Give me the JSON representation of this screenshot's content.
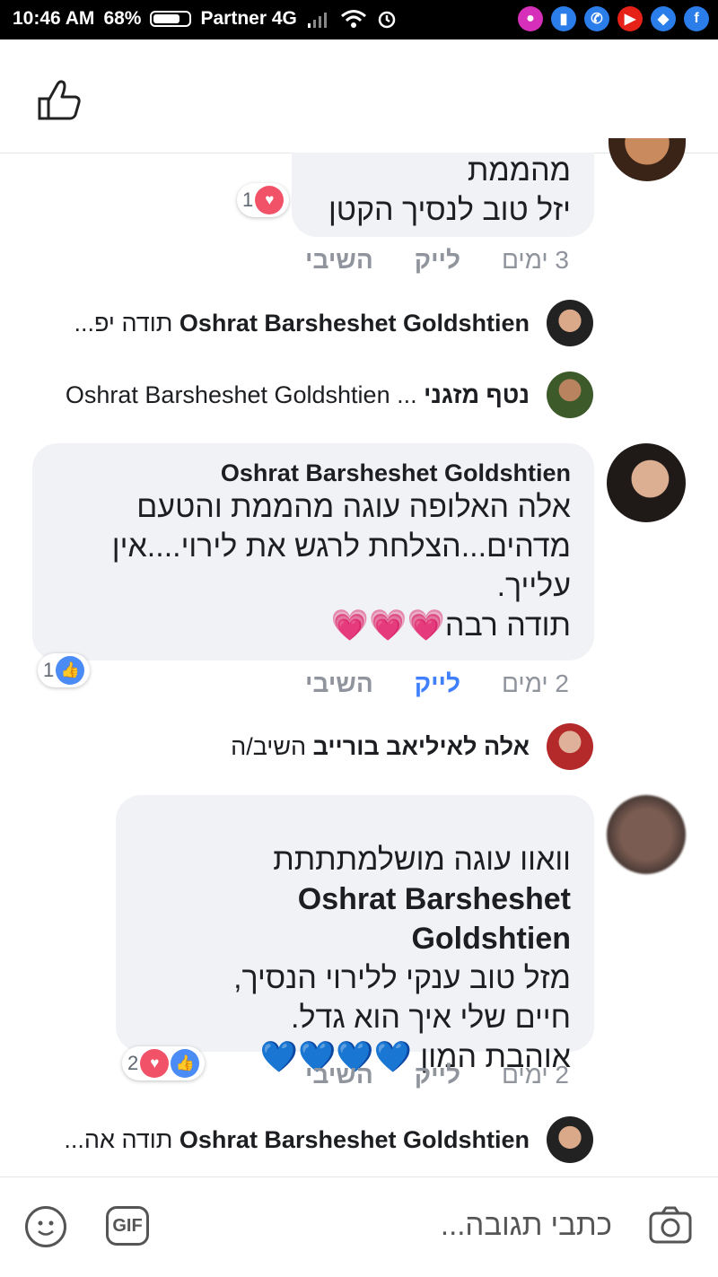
{
  "status_bar": {
    "time": "10:46 AM",
    "battery": "68%",
    "carrier": "Partner 4G",
    "apps": [
      {
        "icon": "messenger-icon",
        "color": "#d62fb9",
        "glyph": "●"
      },
      {
        "icon": "files-icon",
        "color": "#2b7de9",
        "glyph": "▮"
      },
      {
        "icon": "phone-icon",
        "color": "#2b7de9",
        "glyph": "✆"
      },
      {
        "icon": "youtube-icon",
        "color": "#e62117",
        "glyph": "▶"
      },
      {
        "icon": "app-icon",
        "color": "#2b7de9",
        "glyph": "◆"
      },
      {
        "icon": "facebook-icon",
        "color": "#2b7de9",
        "glyph": "f"
      }
    ]
  },
  "comments": {
    "c1": {
      "lines": [
        "מהממת",
        "יזל טוב לנסיך הקטן"
      ],
      "reactions": {
        "count": "1",
        "types": [
          "heart"
        ]
      },
      "time": "3 ימים",
      "like": "לייק",
      "reply": "השיבי"
    },
    "reply1": {
      "name": "Oshrat Barsheshet Goldshtien",
      "text": "תודה יפ..."
    },
    "reply2": {
      "name": "נטף מזגני",
      "text": "... Oshrat Barsheshet Goldshtien"
    },
    "c2": {
      "name": "Oshrat Barsheshet Goldshtien",
      "lines": [
        "אלה האלופה עוגה מהממת והטעם",
        "מדהים...הצלחת לרגש את לירוי....אין",
        "עלייך.",
        "תודה רבה"
      ],
      "emoji": "💗💗💗",
      "reactions": {
        "count": "1",
        "types": [
          "like"
        ]
      },
      "time": "2 ימים",
      "like": "לייק",
      "reply": "השיבי"
    },
    "reply3": {
      "name": "אלה לאיליאב בורייב",
      "text": "השיב/ה"
    },
    "c3": {
      "lines": [
        "וואוו עוגה מושלמתתתת",
        "Oshrat Barsheshet Goldshtien",
        "מזל טוב ענקי ללירוי הנסיך,",
        "חיים שלי איך הוא גדל.",
        "אוהבת המון"
      ],
      "emoji": "💙💙💙💙",
      "reactions": {
        "count": "2",
        "types": [
          "heart",
          "like"
        ]
      },
      "time": "2 ימים",
      "like": "לייק",
      "reply": "השיבי"
    },
    "reply4": {
      "name": "Oshrat Barsheshet Goldshtien",
      "text": "תודה אה..."
    }
  },
  "composer": {
    "placeholder": "כתבי תגובה...",
    "gif_label": "GIF"
  }
}
